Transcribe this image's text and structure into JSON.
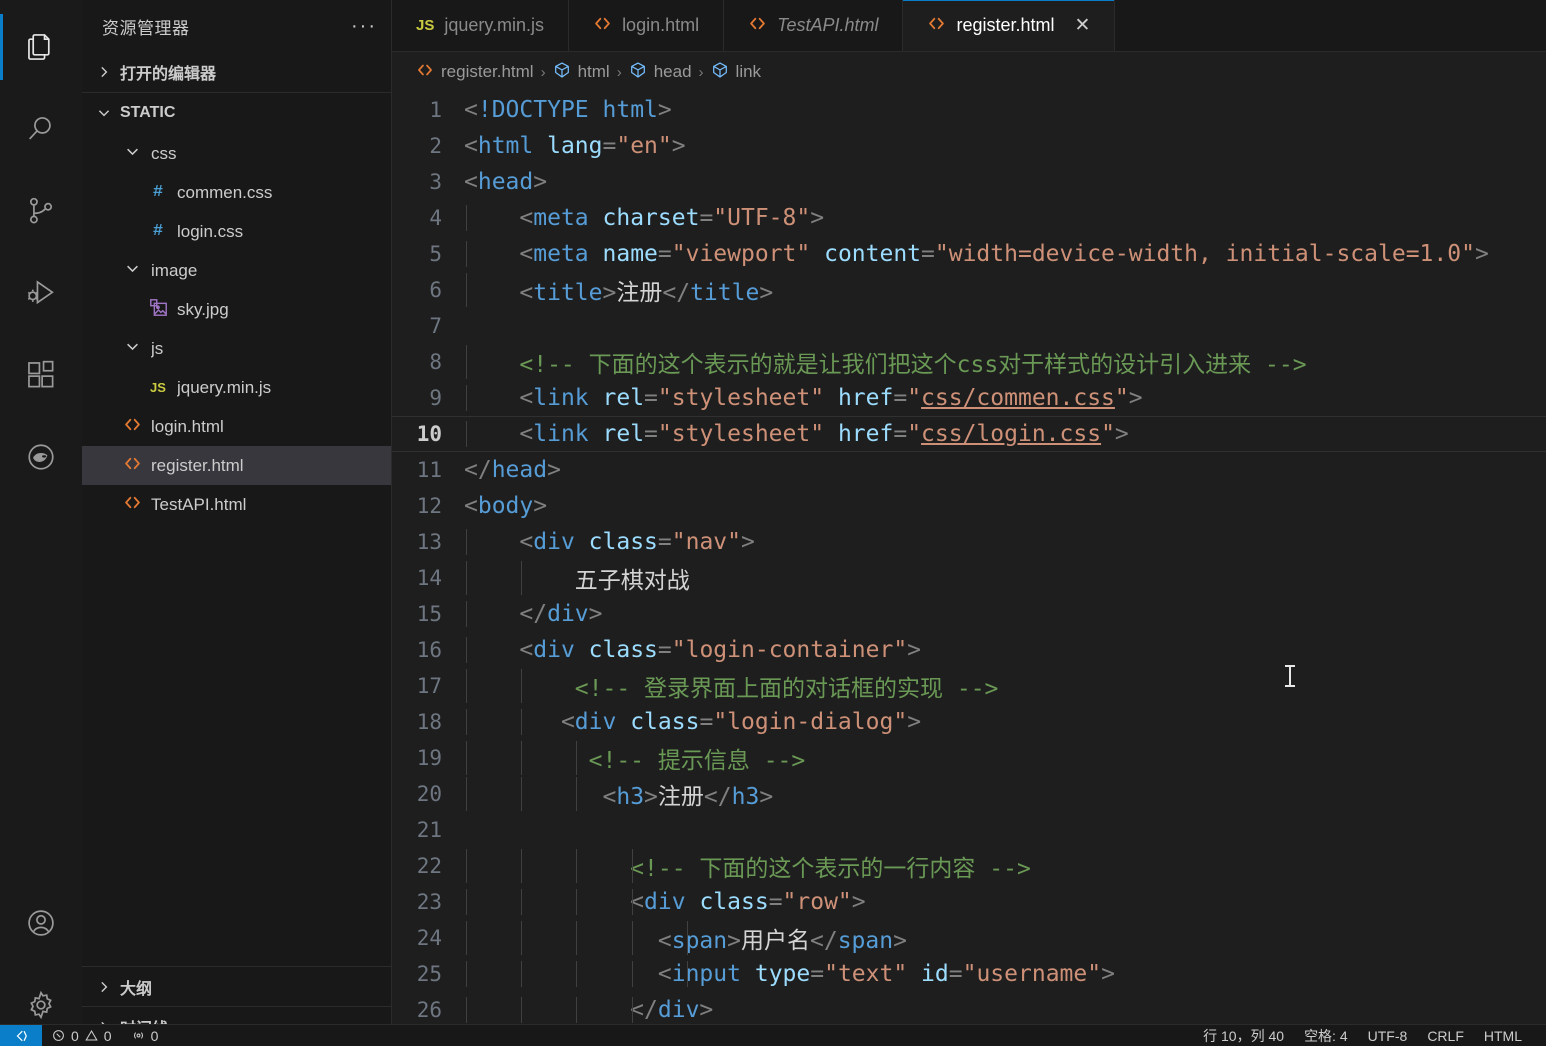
{
  "activity_bar": {
    "items": [
      {
        "name": "explorer",
        "icon": "files-icon",
        "active": true
      },
      {
        "name": "search",
        "icon": "search-icon",
        "active": false
      },
      {
        "name": "source-control",
        "icon": "source-control-icon",
        "active": false
      },
      {
        "name": "run-debug",
        "icon": "run-debug-icon",
        "active": false
      },
      {
        "name": "extensions",
        "icon": "extensions-icon",
        "active": false
      },
      {
        "name": "remote-explorer",
        "icon": "remote-pig-icon",
        "active": false
      }
    ],
    "bottom_items": [
      {
        "name": "accounts",
        "icon": "account-icon"
      },
      {
        "name": "manage",
        "icon": "gear-icon"
      }
    ]
  },
  "sidebar": {
    "title": "资源管理器",
    "more_actions": "···",
    "open_editors_label": "打开的编辑器",
    "workspace_label": "STATIC",
    "tree": [
      {
        "label": "css",
        "indent": 1,
        "kind": "folder",
        "expanded": true,
        "selected": false
      },
      {
        "label": "commen.css",
        "indent": 2,
        "kind": "css",
        "expanded": false,
        "selected": false
      },
      {
        "label": "login.css",
        "indent": 2,
        "kind": "css",
        "expanded": false,
        "selected": false
      },
      {
        "label": "image",
        "indent": 1,
        "kind": "folder",
        "expanded": true,
        "selected": false
      },
      {
        "label": "sky.jpg",
        "indent": 2,
        "kind": "image",
        "expanded": false,
        "selected": false
      },
      {
        "label": "js",
        "indent": 1,
        "kind": "folder",
        "expanded": true,
        "selected": false
      },
      {
        "label": "jquery.min.js",
        "indent": 2,
        "kind": "js",
        "expanded": false,
        "selected": false
      },
      {
        "label": "login.html",
        "indent": 1,
        "kind": "html",
        "expanded": false,
        "selected": false
      },
      {
        "label": "register.html",
        "indent": 1,
        "kind": "html",
        "expanded": false,
        "selected": true
      },
      {
        "label": "TestAPI.html",
        "indent": 1,
        "kind": "html",
        "expanded": false,
        "selected": false
      }
    ],
    "outline_label": "大纲",
    "timeline_label": "时间线"
  },
  "tabs": [
    {
      "label": "jquery.min.js",
      "icon": "js-icon",
      "active": false,
      "preview": false,
      "closable": false
    },
    {
      "label": "login.html",
      "icon": "html-icon",
      "active": false,
      "preview": false,
      "closable": false
    },
    {
      "label": "TestAPI.html",
      "icon": "html-icon",
      "active": false,
      "preview": true,
      "closable": false
    },
    {
      "label": "register.html",
      "icon": "html-icon",
      "active": true,
      "preview": false,
      "closable": true
    }
  ],
  "tab_close_glyph": "✕",
  "breadcrumb": [
    {
      "label": "register.html",
      "icon": "html-icon"
    },
    {
      "label": "html",
      "icon": "symbol-field-icon"
    },
    {
      "label": "head",
      "icon": "symbol-field-icon"
    },
    {
      "label": "link",
      "icon": "symbol-field-icon"
    }
  ],
  "breadcrumb_separator": "›",
  "editor": {
    "filename": "register.html",
    "current_line": 10,
    "lines": [
      {
        "n": 1,
        "indent": 0,
        "tokens": [
          {
            "c": "t-punct",
            "t": "<"
          },
          {
            "c": "t-doctype",
            "t": "!DOCTYPE"
          },
          {
            "c": "t-txt",
            "t": " "
          },
          {
            "c": "t-tag",
            "t": "html"
          },
          {
            "c": "t-punct",
            "t": ">"
          }
        ]
      },
      {
        "n": 2,
        "indent": 0,
        "tokens": [
          {
            "c": "t-punct",
            "t": "<"
          },
          {
            "c": "t-tag",
            "t": "html"
          },
          {
            "c": "t-txt",
            "t": " "
          },
          {
            "c": "t-attr",
            "t": "lang"
          },
          {
            "c": "t-punct",
            "t": "="
          },
          {
            "c": "t-str",
            "t": "\"en\""
          },
          {
            "c": "t-punct",
            "t": ">"
          }
        ]
      },
      {
        "n": 3,
        "indent": 0,
        "tokens": [
          {
            "c": "t-punct",
            "t": "<"
          },
          {
            "c": "t-tag",
            "t": "head"
          },
          {
            "c": "t-punct",
            "t": ">"
          }
        ]
      },
      {
        "n": 4,
        "indent": 1,
        "tokens": [
          {
            "c": "t-txt",
            "t": "    "
          },
          {
            "c": "t-punct",
            "t": "<"
          },
          {
            "c": "t-tag",
            "t": "meta"
          },
          {
            "c": "t-txt",
            "t": " "
          },
          {
            "c": "t-attr",
            "t": "charset"
          },
          {
            "c": "t-punct",
            "t": "="
          },
          {
            "c": "t-str",
            "t": "\"UTF-8\""
          },
          {
            "c": "t-punct",
            "t": ">"
          }
        ]
      },
      {
        "n": 5,
        "indent": 1,
        "tokens": [
          {
            "c": "t-txt",
            "t": "    "
          },
          {
            "c": "t-punct",
            "t": "<"
          },
          {
            "c": "t-tag",
            "t": "meta"
          },
          {
            "c": "t-txt",
            "t": " "
          },
          {
            "c": "t-attr",
            "t": "name"
          },
          {
            "c": "t-punct",
            "t": "="
          },
          {
            "c": "t-str",
            "t": "\"viewport\""
          },
          {
            "c": "t-txt",
            "t": " "
          },
          {
            "c": "t-attr",
            "t": "content"
          },
          {
            "c": "t-punct",
            "t": "="
          },
          {
            "c": "t-str",
            "t": "\"width=device-width, initial-scale=1.0\""
          },
          {
            "c": "t-punct",
            "t": ">"
          }
        ]
      },
      {
        "n": 6,
        "indent": 1,
        "tokens": [
          {
            "c": "t-txt",
            "t": "    "
          },
          {
            "c": "t-punct",
            "t": "<"
          },
          {
            "c": "t-tag",
            "t": "title"
          },
          {
            "c": "t-punct",
            "t": ">"
          },
          {
            "c": "t-txt",
            "t": "注册"
          },
          {
            "c": "t-punct",
            "t": "</"
          },
          {
            "c": "t-tag",
            "t": "title"
          },
          {
            "c": "t-punct",
            "t": ">"
          }
        ]
      },
      {
        "n": 7,
        "indent": 1,
        "tokens": []
      },
      {
        "n": 8,
        "indent": 1,
        "tokens": [
          {
            "c": "t-txt",
            "t": "    "
          },
          {
            "c": "t-com",
            "t": "<!-- 下面的这个表示的就是让我们把这个css对于样式的设计引入进来 -->"
          }
        ]
      },
      {
        "n": 9,
        "indent": 1,
        "tokens": [
          {
            "c": "t-txt",
            "t": "    "
          },
          {
            "c": "t-punct",
            "t": "<"
          },
          {
            "c": "t-tag",
            "t": "link"
          },
          {
            "c": "t-txt",
            "t": " "
          },
          {
            "c": "t-attr",
            "t": "rel"
          },
          {
            "c": "t-punct",
            "t": "="
          },
          {
            "c": "t-str",
            "t": "\"stylesheet\""
          },
          {
            "c": "t-txt",
            "t": " "
          },
          {
            "c": "t-attr",
            "t": "href"
          },
          {
            "c": "t-punct",
            "t": "="
          },
          {
            "c": "t-str",
            "t": "\""
          },
          {
            "c": "t-link",
            "t": "css/commen.css"
          },
          {
            "c": "t-str",
            "t": "\""
          },
          {
            "c": "t-punct",
            "t": ">"
          }
        ]
      },
      {
        "n": 10,
        "indent": 1,
        "tokens": [
          {
            "c": "t-txt",
            "t": "    "
          },
          {
            "c": "t-punct",
            "t": "<"
          },
          {
            "c": "t-tag",
            "t": "link"
          },
          {
            "c": "t-txt",
            "t": " "
          },
          {
            "c": "t-attr",
            "t": "rel"
          },
          {
            "c": "t-punct",
            "t": "="
          },
          {
            "c": "t-str",
            "t": "\"stylesheet\""
          },
          {
            "c": "t-txt",
            "t": " "
          },
          {
            "c": "t-attr",
            "t": "href"
          },
          {
            "c": "t-punct",
            "t": "="
          },
          {
            "c": "t-str",
            "t": "\""
          },
          {
            "c": "t-link",
            "t": "css/login.css"
          },
          {
            "c": "t-str",
            "t": "\""
          },
          {
            "c": "t-punct",
            "t": ">"
          }
        ]
      },
      {
        "n": 11,
        "indent": 0,
        "tokens": [
          {
            "c": "t-punct",
            "t": "</"
          },
          {
            "c": "t-tag",
            "t": "head"
          },
          {
            "c": "t-punct",
            "t": ">"
          }
        ]
      },
      {
        "n": 12,
        "indent": 0,
        "tokens": [
          {
            "c": "t-punct",
            "t": "<"
          },
          {
            "c": "t-tag",
            "t": "body"
          },
          {
            "c": "t-punct",
            "t": ">"
          }
        ]
      },
      {
        "n": 13,
        "indent": 1,
        "tokens": [
          {
            "c": "t-txt",
            "t": "    "
          },
          {
            "c": "t-punct",
            "t": "<"
          },
          {
            "c": "t-tag",
            "t": "div"
          },
          {
            "c": "t-txt",
            "t": " "
          },
          {
            "c": "t-attr",
            "t": "class"
          },
          {
            "c": "t-punct",
            "t": "="
          },
          {
            "c": "t-str",
            "t": "\"nav\""
          },
          {
            "c": "t-punct",
            "t": ">"
          }
        ]
      },
      {
        "n": 14,
        "indent": 2,
        "tokens": [
          {
            "c": "t-txt",
            "t": "        五子棋对战"
          }
        ]
      },
      {
        "n": 15,
        "indent": 1,
        "tokens": [
          {
            "c": "t-txt",
            "t": "    "
          },
          {
            "c": "t-punct",
            "t": "</"
          },
          {
            "c": "t-tag",
            "t": "div"
          },
          {
            "c": "t-punct",
            "t": ">"
          }
        ]
      },
      {
        "n": 16,
        "indent": 1,
        "tokens": [
          {
            "c": "t-txt",
            "t": "    "
          },
          {
            "c": "t-punct",
            "t": "<"
          },
          {
            "c": "t-tag",
            "t": "div"
          },
          {
            "c": "t-txt",
            "t": " "
          },
          {
            "c": "t-attr",
            "t": "class"
          },
          {
            "c": "t-punct",
            "t": "="
          },
          {
            "c": "t-str",
            "t": "\"login-container\""
          },
          {
            "c": "t-punct",
            "t": ">"
          }
        ]
      },
      {
        "n": 17,
        "indent": 2,
        "tokens": [
          {
            "c": "t-txt",
            "t": "        "
          },
          {
            "c": "t-com",
            "t": "<!-- 登录界面上面的对话框的实现 -->"
          }
        ]
      },
      {
        "n": 18,
        "indent": 2,
        "tokens": [
          {
            "c": "t-txt",
            "t": "       "
          },
          {
            "c": "t-punct",
            "t": "<"
          },
          {
            "c": "t-tag",
            "t": "div"
          },
          {
            "c": "t-txt",
            "t": " "
          },
          {
            "c": "t-attr",
            "t": "class"
          },
          {
            "c": "t-punct",
            "t": "="
          },
          {
            "c": "t-str",
            "t": "\"login-dialog\""
          },
          {
            "c": "t-punct",
            "t": ">"
          }
        ]
      },
      {
        "n": 19,
        "indent": 3,
        "tokens": [
          {
            "c": "t-txt",
            "t": "         "
          },
          {
            "c": "t-com",
            "t": "<!-- 提示信息 -->"
          }
        ]
      },
      {
        "n": 20,
        "indent": 3,
        "tokens": [
          {
            "c": "t-txt",
            "t": "          "
          },
          {
            "c": "t-punct",
            "t": "<"
          },
          {
            "c": "t-tag",
            "t": "h3"
          },
          {
            "c": "t-punct",
            "t": ">"
          },
          {
            "c": "t-txt",
            "t": "注册"
          },
          {
            "c": "t-punct",
            "t": "</"
          },
          {
            "c": "t-tag",
            "t": "h3"
          },
          {
            "c": "t-punct",
            "t": ">"
          }
        ]
      },
      {
        "n": 21,
        "indent": 3,
        "tokens": []
      },
      {
        "n": 22,
        "indent": 4,
        "tokens": [
          {
            "c": "t-txt",
            "t": "            "
          },
          {
            "c": "t-com",
            "t": "<!-- 下面的这个表示的一行内容 -->"
          }
        ]
      },
      {
        "n": 23,
        "indent": 4,
        "tokens": [
          {
            "c": "t-txt",
            "t": "            "
          },
          {
            "c": "t-punct",
            "t": "<"
          },
          {
            "c": "t-tag",
            "t": "div"
          },
          {
            "c": "t-txt",
            "t": " "
          },
          {
            "c": "t-attr",
            "t": "class"
          },
          {
            "c": "t-punct",
            "t": "="
          },
          {
            "c": "t-str",
            "t": "\"row\""
          },
          {
            "c": "t-punct",
            "t": ">"
          }
        ]
      },
      {
        "n": 24,
        "indent": 5,
        "tokens": [
          {
            "c": "t-txt",
            "t": "              "
          },
          {
            "c": "t-punct",
            "t": "<"
          },
          {
            "c": "t-tag",
            "t": "span"
          },
          {
            "c": "t-punct",
            "t": ">"
          },
          {
            "c": "t-txt",
            "t": "用户名"
          },
          {
            "c": "t-punct",
            "t": "</"
          },
          {
            "c": "t-tag",
            "t": "span"
          },
          {
            "c": "t-punct",
            "t": ">"
          }
        ]
      },
      {
        "n": 25,
        "indent": 5,
        "tokens": [
          {
            "c": "t-txt",
            "t": "              "
          },
          {
            "c": "t-punct",
            "t": "<"
          },
          {
            "c": "t-tag",
            "t": "input"
          },
          {
            "c": "t-txt",
            "t": " "
          },
          {
            "c": "t-attr",
            "t": "type"
          },
          {
            "c": "t-punct",
            "t": "="
          },
          {
            "c": "t-str",
            "t": "\"text\""
          },
          {
            "c": "t-txt",
            "t": " "
          },
          {
            "c": "t-attr",
            "t": "id"
          },
          {
            "c": "t-punct",
            "t": "="
          },
          {
            "c": "t-str",
            "t": "\"username\""
          },
          {
            "c": "t-punct",
            "t": ">"
          }
        ]
      },
      {
        "n": 26,
        "indent": 4,
        "tokens": [
          {
            "c": "t-txt",
            "t": "            "
          },
          {
            "c": "t-punct",
            "t": "</"
          },
          {
            "c": "t-tag",
            "t": "div"
          },
          {
            "c": "t-punct",
            "t": ">"
          }
        ]
      }
    ]
  },
  "status_bar": {
    "remote_label": "",
    "problems_errors": "0",
    "problems_warnings": "0",
    "ports": "0",
    "cursor_position": "行 10，列 40",
    "indentation": "空格: 4",
    "encoding": "UTF-8",
    "eol": "CRLF",
    "language": "HTML"
  },
  "colors": {
    "accent": "#0a7ec8",
    "editor_bg": "#1e1e1e",
    "sidebar_bg": "#181818",
    "selection_bg": "#37373d",
    "html_icon": "#e37933",
    "css_icon": "#4a9fd4",
    "js_icon": "#cbcb41",
    "image_icon": "#a074c4",
    "symbol_icon": "#75beff"
  }
}
